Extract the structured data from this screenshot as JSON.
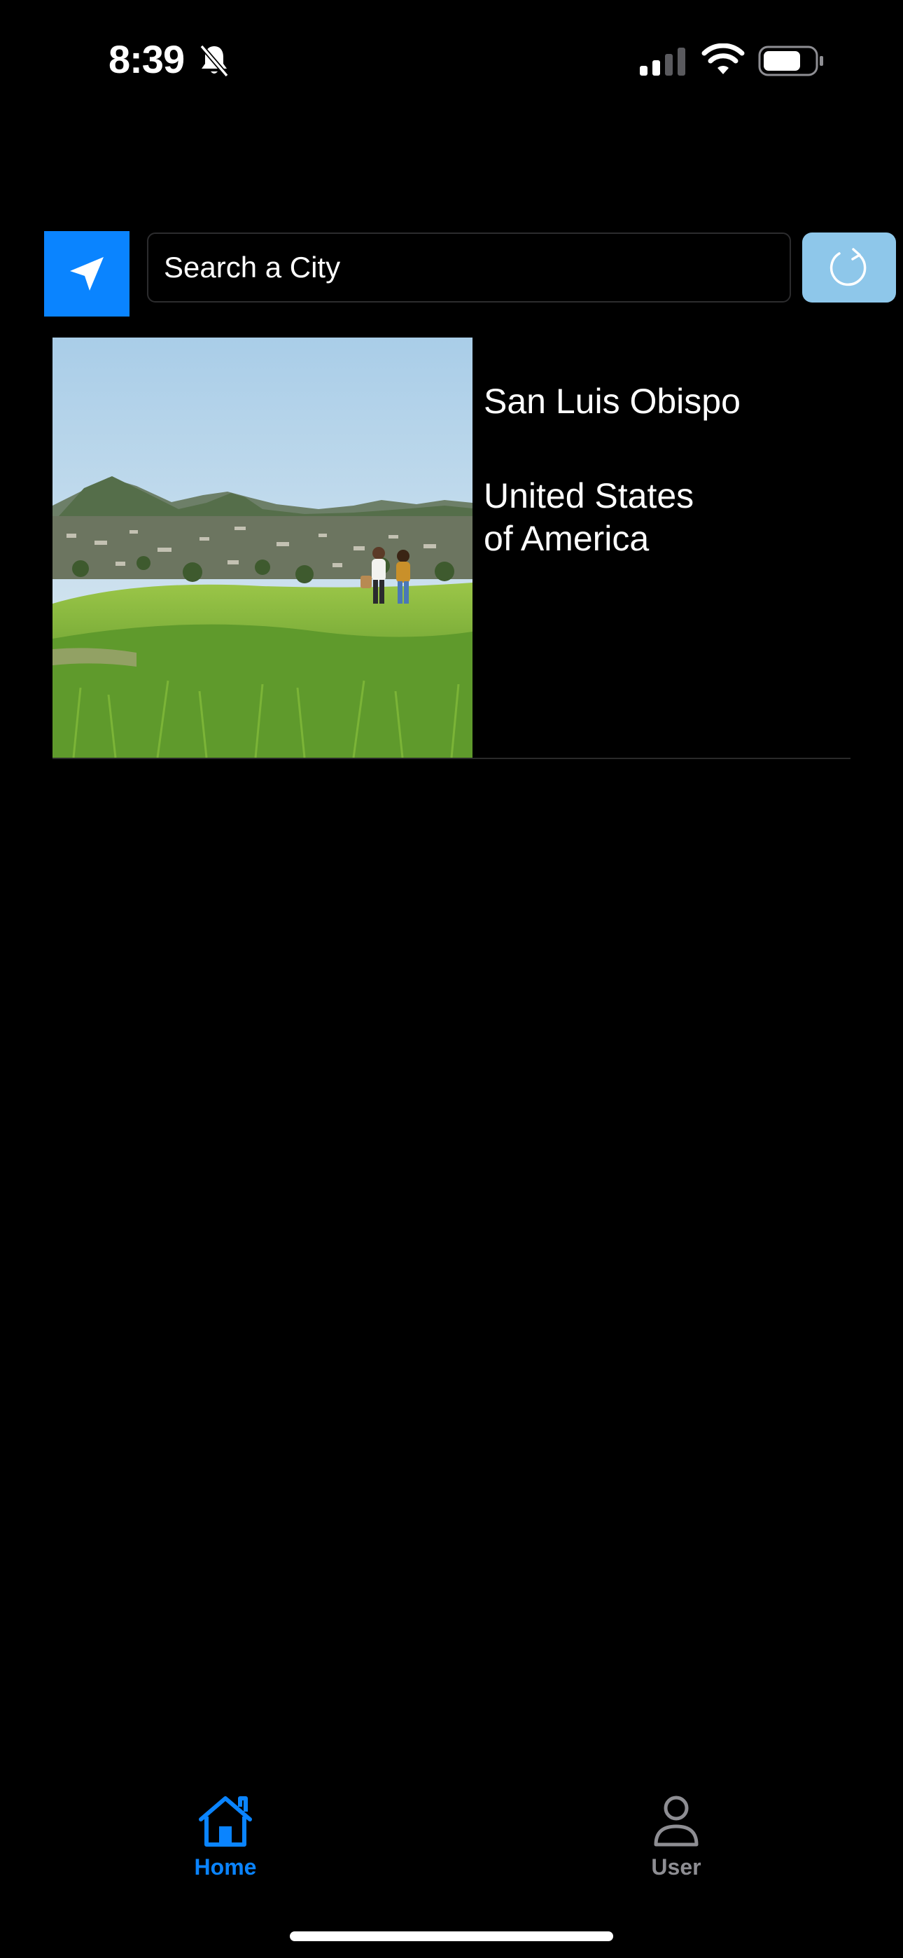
{
  "status_bar": {
    "time": "8:39",
    "icons": [
      "bell-slash-icon",
      "cellular-signal-icon",
      "wifi-icon",
      "battery-icon"
    ]
  },
  "search": {
    "placeholder": "Search a City",
    "locate_icon": "location-arrow-icon",
    "refresh_icon": "refresh-icon"
  },
  "city": {
    "name": "San Luis Obispo",
    "country": "United States of America",
    "photo": "city-photo"
  },
  "tabs": [
    {
      "label": "Home",
      "icon": "house-icon",
      "active": true
    },
    {
      "label": "User",
      "icon": "person-icon",
      "active": false
    }
  ],
  "colors": {
    "background": "#000000",
    "accent": "#0a84ff",
    "refresh_button": "#8ec7ea",
    "inactive_tab": "#8e8e93"
  }
}
